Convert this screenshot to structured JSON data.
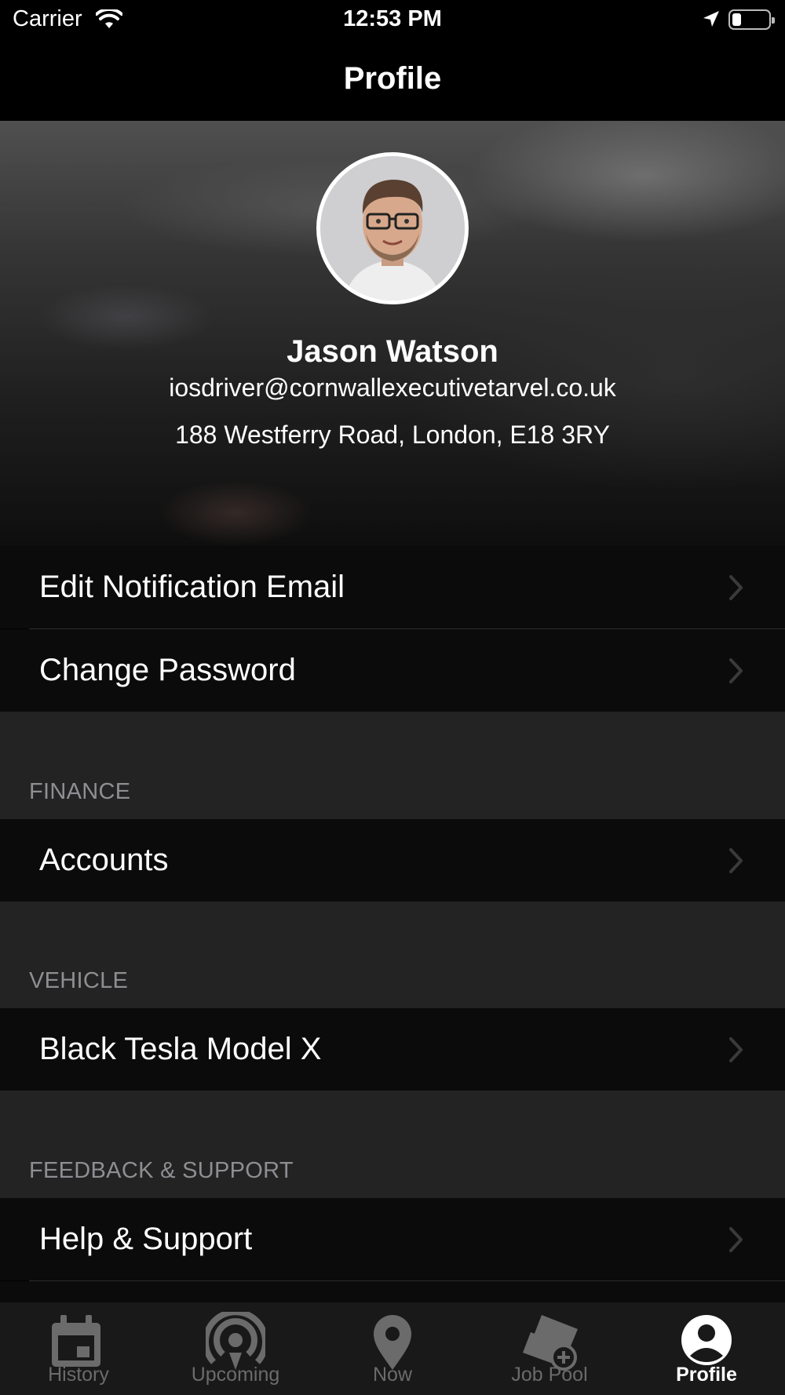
{
  "status_bar": {
    "carrier": "Carrier",
    "time": "12:53 PM"
  },
  "nav": {
    "title": "Profile"
  },
  "profile": {
    "name": "Jason Watson",
    "email": "iosdriver@cornwallexecutivetarvel.co.uk",
    "address": "188 Westferry Road, London, E18 3RY"
  },
  "account_rows": [
    {
      "label": "Edit Notification Email",
      "icon": "chevron-right-icon"
    },
    {
      "label": "Change Password",
      "icon": "chevron-right-icon"
    }
  ],
  "sections": [
    {
      "title": "FINANCE",
      "rows": [
        {
          "label": "Accounts"
        }
      ]
    },
    {
      "title": "VEHICLE",
      "rows": [
        {
          "label": "Black Tesla Model X"
        }
      ]
    },
    {
      "title": "FEEDBACK & SUPPORT",
      "rows": [
        {
          "label": "Help & Support"
        }
      ]
    }
  ],
  "tab_bar": {
    "tabs": [
      {
        "label": "History",
        "icon": "calendar-icon"
      },
      {
        "label": "Upcoming",
        "icon": "broadcast-icon"
      },
      {
        "label": "Now",
        "icon": "map-pin-icon"
      },
      {
        "label": "Job Pool",
        "icon": "ticket-add-icon"
      },
      {
        "label": "Profile",
        "icon": "account-circle-icon"
      }
    ],
    "active": "Profile",
    "active_color": "#ffffff",
    "inactive_color": "#6b6b6b"
  }
}
